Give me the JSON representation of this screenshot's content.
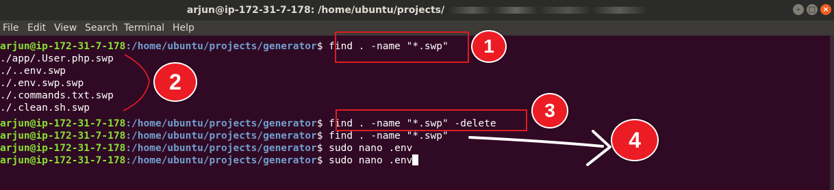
{
  "window": {
    "title": "arjun@ip-172-31-7-178: /home/ubuntu/projects/",
    "buttons": {
      "minimize": "–",
      "maximize": "□",
      "close": "×"
    }
  },
  "menu": [
    "File",
    "Edit",
    "View",
    "Search",
    "Terminal",
    "Help"
  ],
  "prompt": {
    "user_host": "arjun@ip-172-31-7-178",
    "path": ":/home/ubuntu/projects/generator",
    "symbol": "$ "
  },
  "lines": [
    {
      "kind": "prompt",
      "command": "find . -name \"*.swp\""
    },
    {
      "kind": "output",
      "text": "./app/.User.php.swp"
    },
    {
      "kind": "output",
      "text": "./..env.swp"
    },
    {
      "kind": "output",
      "text": "./.env.swp.swp"
    },
    {
      "kind": "output",
      "text": "./.commands.txt.swp"
    },
    {
      "kind": "output",
      "text": "./.clean.sh.swp"
    },
    {
      "kind": "prompt",
      "command": "find . -name \"*.swp\" -delete"
    },
    {
      "kind": "prompt",
      "command": "find . -name \"*.swp\""
    },
    {
      "kind": "prompt",
      "command": "sudo nano .env"
    },
    {
      "kind": "prompt",
      "command": "sudo nano .env"
    }
  ],
  "annotations": {
    "badge1": "1",
    "badge2": "2",
    "badge3": "3",
    "badge4": "4"
  },
  "colors": {
    "terminal_bg": "#300a24",
    "prompt_user": "#8ae234",
    "prompt_path": "#729fcf",
    "annotation_red": "#ec1c24"
  }
}
